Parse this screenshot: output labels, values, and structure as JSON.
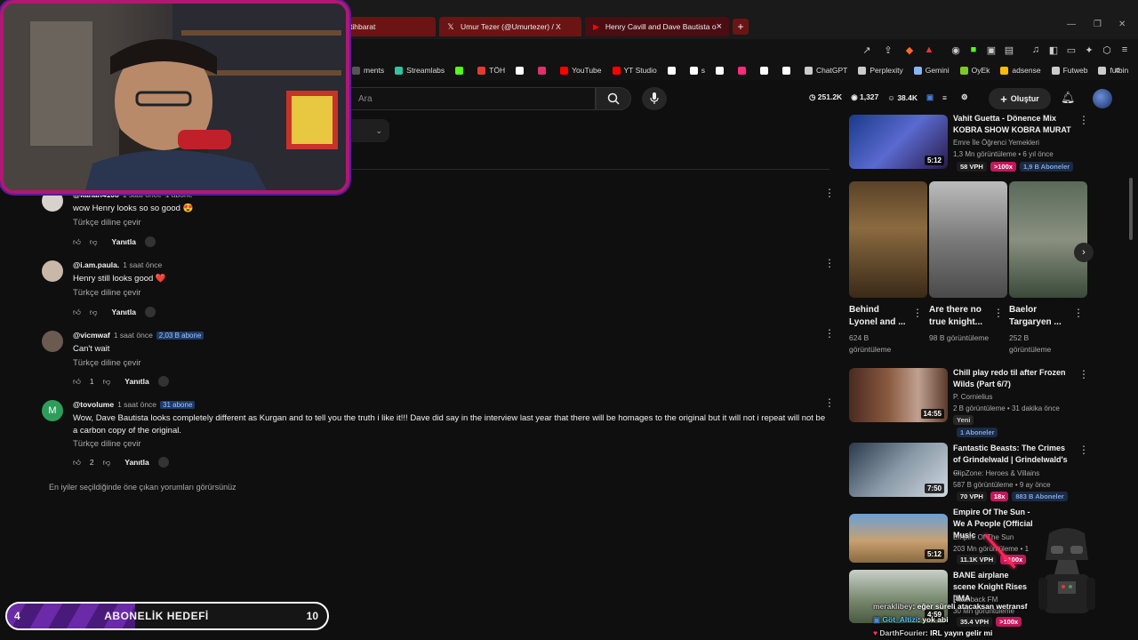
{
  "browser": {
    "tabs": [
      {
        "label": "tihbarat"
      },
      {
        "label": "Umur Tezer (@Umurtezer) / X"
      },
      {
        "label": "Henry Cavill and Dave Bautista o"
      }
    ],
    "new_tab": "+",
    "bookmarks": [
      {
        "label": "ments",
        "color": "#555555"
      },
      {
        "label": "Streamlabs",
        "color": "#31c3a2"
      },
      {
        "label": "",
        "color": "#53fc18"
      },
      {
        "label": "TÖH",
        "color": "#e53935"
      },
      {
        "label": "",
        "color": "#ffffff"
      },
      {
        "label": "",
        "color": "#e1306c"
      },
      {
        "label": "YouTube",
        "color": "#ff0000"
      },
      {
        "label": "YT Studio",
        "color": "#ff0000"
      },
      {
        "label": "",
        "color": "#ffffff"
      },
      {
        "label": "s",
        "color": "#ffffff"
      },
      {
        "label": "",
        "color": "#ffffff"
      },
      {
        "label": "",
        "color": "#ff2a7a"
      },
      {
        "label": "",
        "color": "#ffffff"
      },
      {
        "label": "",
        "color": "#ffffff"
      },
      {
        "label": "ChatGPT",
        "color": "#cccccc"
      },
      {
        "label": "Perplexity",
        "color": "#cccccc"
      },
      {
        "label": "Gemini",
        "color": "#8ab4f8"
      },
      {
        "label": "OyEk",
        "color": "#7ecb20"
      },
      {
        "label": "adsense",
        "color": "#fbbc04"
      },
      {
        "label": "Futweb",
        "color": "#cccccc"
      },
      {
        "label": "futbin",
        "color": "#cccccc"
      }
    ],
    "bookmarks_more": "»"
  },
  "header": {
    "search_placeholder": "Ara",
    "stats": [
      "251.2K",
      "1,327",
      "38.4K"
    ],
    "create_label": "Oluştur"
  },
  "comments": [
    {
      "author": "@kanan4108",
      "time": "1 saat önce",
      "badge": "1 abone",
      "text": "wow Henry looks so so good 😍",
      "translate": "Türkçe diline çevir",
      "likes": "",
      "reply": "Yanıtla",
      "avatar_color": "#d8d2cc",
      "avatar_letter": ""
    },
    {
      "author": "@i.am.paula.",
      "time": "1 saat önce",
      "badge": "",
      "text": "Henry still looks good ❤️",
      "translate": "Türkçe diline çevir",
      "likes": "",
      "reply": "Yanıtla",
      "avatar_color": "#c9b8a8",
      "avatar_letter": ""
    },
    {
      "author": "@vicmwaf",
      "time": "1 saat önce",
      "badge": "2,03 B abone",
      "text": "Can't wait",
      "translate": "Türkçe diline çevir",
      "likes": "1",
      "reply": "Yanıtla",
      "avatar_color": "#6b5a50",
      "avatar_letter": ""
    },
    {
      "author": "@tovolume",
      "time": "1 saat önce",
      "badge": "31 abone",
      "text": "Wow, Dave Bautista looks completely different as Kurgan and to tell you the truth i like it!!! Dave did say in the interview last year that there will be homages to the original but it will not i repeat will not be a carbon copy of the original.",
      "translate": "Türkçe diline çevir",
      "likes": "2",
      "reply": "Yanıtla",
      "avatar_color": "#2e9d5a",
      "avatar_letter": "M"
    }
  ],
  "footer_note": "En iyiler seçildiğinde öne çıkan yorumları görürsünüz",
  "sidebar": {
    "videos": [
      {
        "title": "Vahit Guetta - Dönence Mix KOBRA SHOW KOBRA MURAT",
        "channel": "Emre İle Öğrenci Yemekleri",
        "meta": "1,3 Mn görüntüleme • 6 yıl önce",
        "duration": "5:12",
        "vph": "58 VPH",
        "pct": ">100x",
        "subs": "1,9 B Aboneler",
        "new": ""
      },
      {
        "title": "Chill play redo til after Frozen Wilds (Part 6/7)",
        "channel": "P. Cornielius",
        "meta": "2 B görüntüleme • 31 dakika önce",
        "duration": "14:55",
        "vph": "",
        "pct": "",
        "subs": "1 Aboneler",
        "new": "Yeni"
      },
      {
        "title": "Fantastic Beasts: The Crimes of Grindelwald | Grindelwald's ...",
        "channel": "ClipZone: Heroes & Villains",
        "meta": "587 B görüntüleme • 9 ay önce",
        "duration": "7:50",
        "vph": "70 VPH",
        "pct": "18x",
        "subs": "883 B Aboneler",
        "new": ""
      },
      {
        "title": "Empire Of The Sun - We A People (Official Music",
        "channel": "Empire Of The Sun",
        "meta": "203 Mn görüntüleme • 1",
        "duration": "5:12",
        "vph": "11.1K VPH",
        "pct": ">100x",
        "subs": "",
        "new": ""
      },
      {
        "title": "BANE airplane scene Knight Rises [IMA",
        "channel": "Flashback FM",
        "meta": "30 Mn görüntüleme",
        "duration": "4:59",
        "vph": "35.4 VPH",
        "pct": ">100x",
        "subs": "",
        "new": ""
      }
    ],
    "shorts": [
      {
        "title": "Behind Lyonel and ...",
        "views": "624 B görüntüleme"
      },
      {
        "title": "Are there no true knight...",
        "views": "98 B görüntüleme"
      },
      {
        "title": "Baelor Targaryen ...",
        "views": "252 B görüntüleme"
      }
    ]
  },
  "overlay": {
    "goal_current": "4",
    "goal_title": "ABONELİK HEDEFİ",
    "goal_target": "10",
    "goal_progress": 0.4,
    "chat": [
      {
        "user": "meraklibey",
        "msg": ": eğer süreli atacaksan wetransf"
      },
      {
        "user": "Göt_Altizi",
        "msg": ": yok abi"
      },
      {
        "user": "DarthFourier",
        "msg": ": IRL yayın gelir mi"
      }
    ]
  },
  "colors": {
    "accent": "#b01872",
    "goal_fill": "#6b2aa8",
    "yt_red": "#ff0000"
  }
}
